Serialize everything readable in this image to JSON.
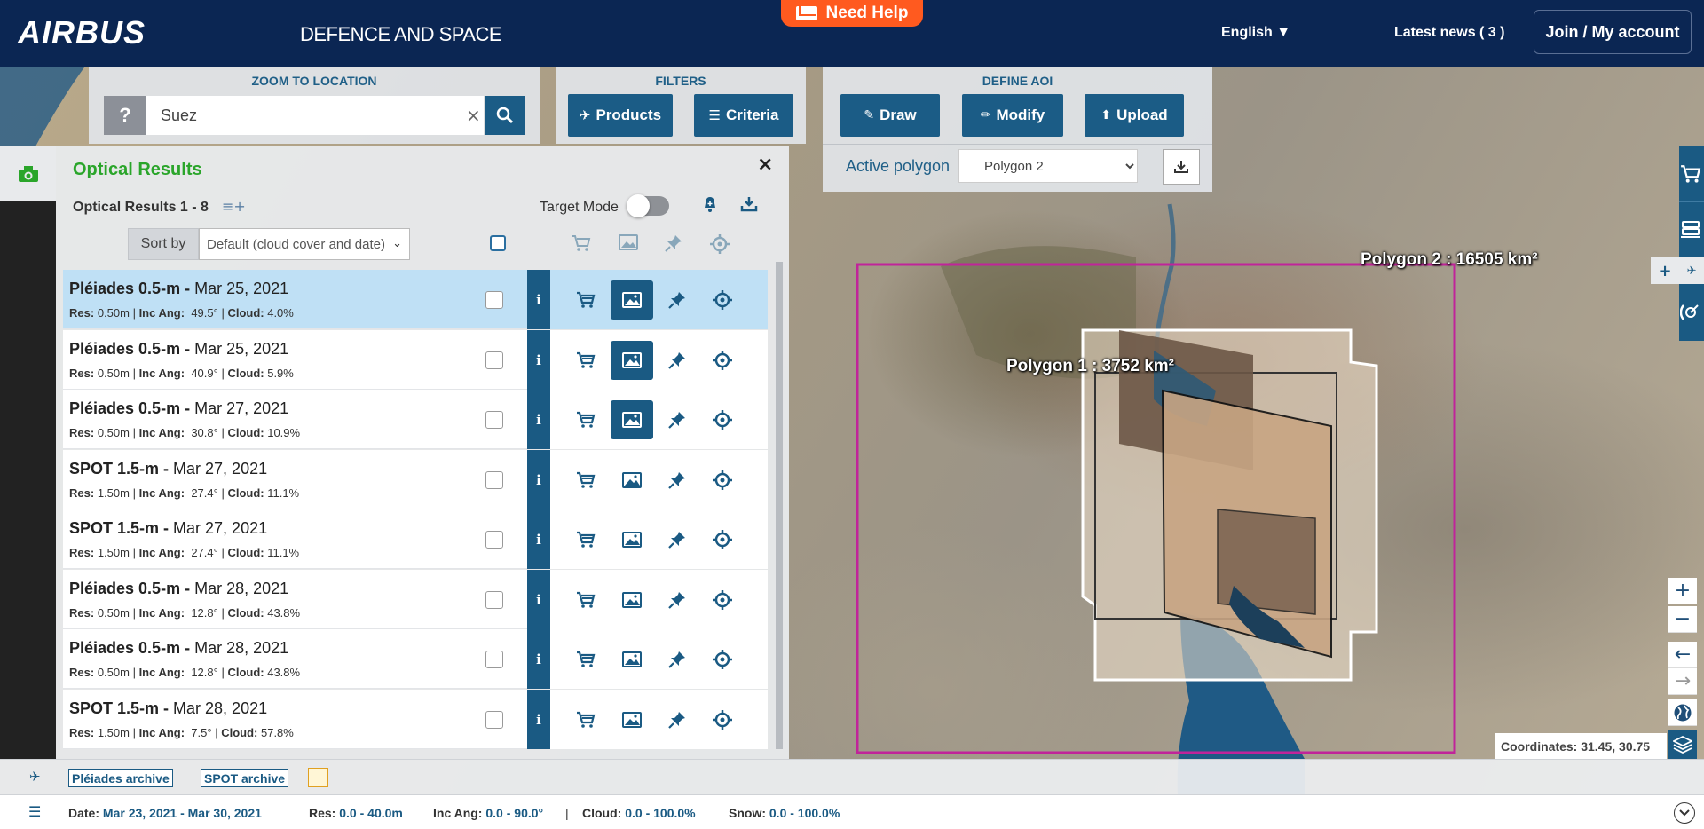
{
  "header": {
    "logo": "AIRBUS",
    "subtitle": "DEFENCE AND SPACE",
    "need_help": "Need Help",
    "language": "English ▼",
    "latest_news": "Latest news  ( 3 )",
    "account": "Join / My account"
  },
  "zoom": {
    "title": "ZOOM TO LOCATION",
    "help": "?",
    "query": "Suez",
    "clear": "×"
  },
  "filters": {
    "title": "FILTERS",
    "products": "Products",
    "criteria": "Criteria"
  },
  "aoi": {
    "title": "DEFINE AOI",
    "draw": "Draw",
    "modify": "Modify",
    "upload": "Upload",
    "active_label": "Active polygon",
    "active_value": "Polygon 2"
  },
  "panel": {
    "title": "Optical Results",
    "close": "×",
    "count": "Optical Results 1 - 8",
    "target_mode": "Target Mode",
    "sort_label": "Sort by",
    "sort_value": "Default (cloud cover and date)"
  },
  "results": [
    {
      "sensor": "Pléiades 0.5-m",
      "date": "Mar 25, 2021",
      "res": "0.50m",
      "inc": "49.5°",
      "cloud": "4.0%",
      "selected": true,
      "quicklook_on": true
    },
    {
      "sensor": "Pléiades 0.5-m",
      "date": "Mar 25, 2021",
      "res": "0.50m",
      "inc": "40.9°",
      "cloud": "5.9%",
      "selected": false,
      "quicklook_on": true
    },
    {
      "sensor": "Pléiades 0.5-m",
      "date": "Mar 27, 2021",
      "res": "0.50m",
      "inc": "30.8°",
      "cloud": "10.9%",
      "selected": false,
      "quicklook_on": true
    },
    {
      "sensor": "SPOT 1.5-m",
      "date": "Mar 27, 2021",
      "res": "1.50m",
      "inc": "27.4°",
      "cloud": "11.1%",
      "selected": false,
      "quicklook_on": false
    },
    {
      "sensor": "SPOT 1.5-m",
      "date": "Mar 27, 2021",
      "res": "1.50m",
      "inc": "27.4°",
      "cloud": "11.1%",
      "selected": false,
      "quicklook_on": false
    },
    {
      "sensor": "Pléiades 0.5-m",
      "date": "Mar 28, 2021",
      "res": "0.50m",
      "inc": "12.8°",
      "cloud": "43.8%",
      "selected": false,
      "quicklook_on": false
    },
    {
      "sensor": "Pléiades 0.5-m",
      "date": "Mar 28, 2021",
      "res": "0.50m",
      "inc": "12.8°",
      "cloud": "43.8%",
      "selected": false,
      "quicklook_on": false
    },
    {
      "sensor": "SPOT 1.5-m",
      "date": "Mar 28, 2021",
      "res": "1.50m",
      "inc": "7.5°",
      "cloud": "57.8%",
      "selected": false,
      "quicklook_on": false
    }
  ],
  "result_labels": {
    "res": "Res:",
    "inc": "Inc Ang:",
    "cloud": "Cloud:",
    "info": "i"
  },
  "map": {
    "polygon1_label": "Polygon 1 : 3752 km²",
    "polygon2_label": "Polygon 2 : 16505 km²",
    "coordinates": "Coordinates: 31.45, 30.75"
  },
  "archives": {
    "pleiades": "Pléiades archive",
    "spot": "SPOT archive"
  },
  "filter_summary": {
    "date_label": "Date:",
    "date_value": "Mar 23, 2021 - Mar 30, 2021",
    "res_label": "Res:",
    "res_value": "0.0 - 40.0m",
    "inc_label": "Inc Ang:",
    "inc_value": "0.0 - 90.0°",
    "sep": "|",
    "cloud_label": "Cloud:",
    "cloud_value": "0.0 - 100.0%",
    "snow_label": "Snow:",
    "snow_value": "0.0 - 100.0%"
  },
  "colors": {
    "navy": "#0b2653",
    "accent": "#1a5a83",
    "help": "#ff5a1f",
    "green": "#2aa52a",
    "polygon2": "#c0249a"
  },
  "icons": [
    "cart-icon",
    "image-icon",
    "pin-icon",
    "target-icon",
    "camera-icon",
    "search-icon",
    "download-icon",
    "bell-icon",
    "layers-icon",
    "globe-icon"
  ]
}
